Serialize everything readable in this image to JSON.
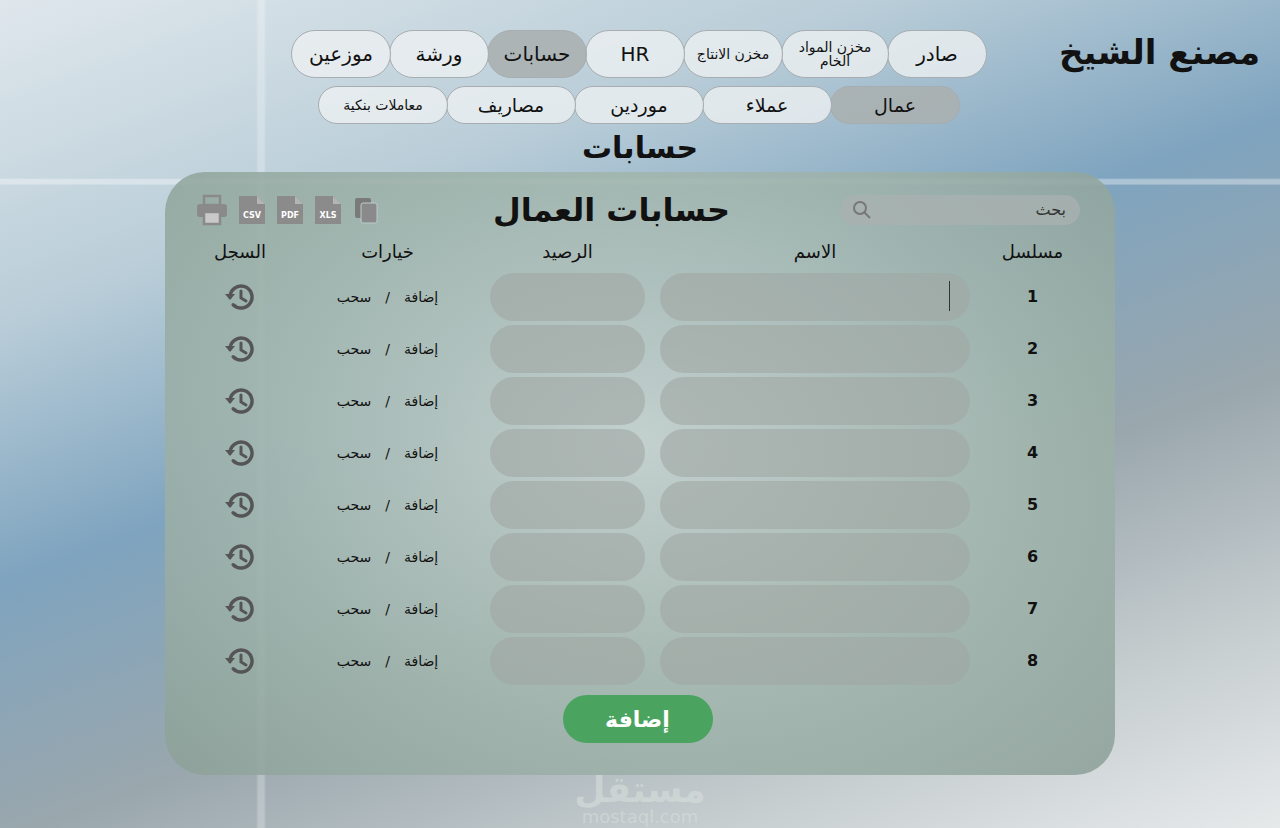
{
  "brand": "مصنع الشيخ",
  "main_tabs": [
    {
      "label": "صادر",
      "selected": false
    },
    {
      "label": "مخزن المواد الخام",
      "selected": false
    },
    {
      "label": "مخزن الانتاج",
      "selected": false
    },
    {
      "label": "HR",
      "selected": false
    },
    {
      "label": "حسابات",
      "selected": true
    },
    {
      "label": "ورشة",
      "selected": false
    },
    {
      "label": "موزعين",
      "selected": false
    }
  ],
  "sub_tabs": [
    {
      "label": "عمال",
      "selected": true
    },
    {
      "label": "عملاء",
      "selected": false
    },
    {
      "label": "موردين",
      "selected": false
    },
    {
      "label": "مصاريف",
      "selected": false
    },
    {
      "label": "معاملات بنكية",
      "selected": false
    }
  ],
  "section_title": "حسابات",
  "panel": {
    "title": "حسابات العمال",
    "search": {
      "placeholder": "بحث"
    },
    "exports": [
      {
        "kind": "copy"
      },
      {
        "kind": "file",
        "label": "XLS"
      },
      {
        "kind": "file",
        "label": "PDF"
      },
      {
        "kind": "file",
        "label": "CSV"
      },
      {
        "kind": "print"
      }
    ]
  },
  "table": {
    "columns": [
      "مسلسل",
      "الاسم",
      "الرصيد",
      "خيارات",
      "السجل"
    ],
    "rows": [
      {
        "serial": "1",
        "name": "",
        "balance": "",
        "focused": true,
        "actions": [
          "إضافة",
          "/",
          "سحب"
        ]
      },
      {
        "serial": "2",
        "name": "",
        "balance": "",
        "focused": false,
        "actions": [
          "إضافة",
          "/",
          "سحب"
        ]
      },
      {
        "serial": "3",
        "name": "",
        "balance": "",
        "focused": false,
        "actions": [
          "إضافة",
          "/",
          "سحب"
        ]
      },
      {
        "serial": "4",
        "name": "",
        "balance": "",
        "focused": false,
        "actions": [
          "إضافة",
          "/",
          "سحب"
        ]
      },
      {
        "serial": "5",
        "name": "",
        "balance": "",
        "focused": false,
        "actions": [
          "إضافة",
          "/",
          "سحب"
        ]
      },
      {
        "serial": "6",
        "name": "",
        "balance": "",
        "focused": false,
        "actions": [
          "إضافة",
          "/",
          "سحب"
        ]
      },
      {
        "serial": "7",
        "name": "",
        "balance": "",
        "focused": false,
        "actions": [
          "إضافة",
          "/",
          "سحب"
        ]
      },
      {
        "serial": "8",
        "name": "",
        "balance": "",
        "focused": false,
        "actions": [
          "إضافة",
          "/",
          "سحب"
        ]
      }
    ]
  },
  "add_button": "إضافة",
  "watermark": {
    "text": "مستقل",
    "url": "mostaql.com"
  }
}
